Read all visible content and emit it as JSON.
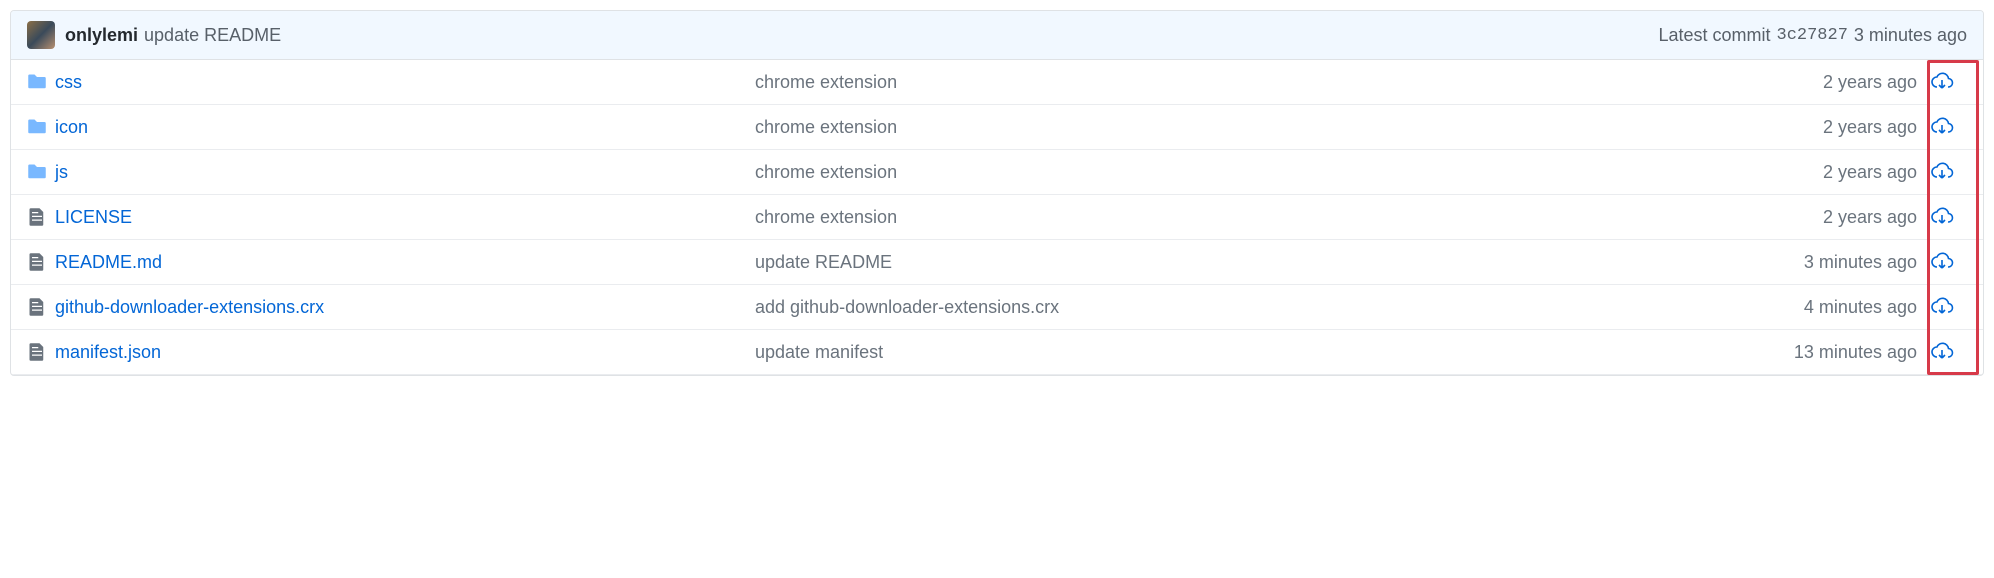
{
  "header": {
    "author": "onlylemi",
    "commit_message": "update README",
    "latest_commit_label": "Latest commit",
    "sha": "3c27827",
    "time": "3 minutes ago"
  },
  "files": [
    {
      "type": "folder",
      "name": "css",
      "commit_msg": "chrome extension",
      "age": "2 years ago"
    },
    {
      "type": "folder",
      "name": "icon",
      "commit_msg": "chrome extension",
      "age": "2 years ago"
    },
    {
      "type": "folder",
      "name": "js",
      "commit_msg": "chrome extension",
      "age": "2 years ago"
    },
    {
      "type": "file",
      "name": "LICENSE",
      "commit_msg": "chrome extension",
      "age": "2 years ago"
    },
    {
      "type": "file",
      "name": "README.md",
      "commit_msg": "update README",
      "age": "3 minutes ago"
    },
    {
      "type": "file",
      "name": "github-downloader-extensions.crx",
      "commit_msg": "add github-downloader-extensions.crx",
      "age": "4 minutes ago"
    },
    {
      "type": "file",
      "name": "manifest.json",
      "commit_msg": "update manifest",
      "age": "13 minutes ago"
    }
  ]
}
